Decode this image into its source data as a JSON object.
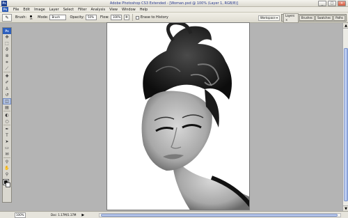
{
  "window": {
    "app_icon": "Ps",
    "title": "Adobe Photoshop CS3 Extended - [Woman.psd @ 100% (Layer 1, RGB/8)]",
    "minimize": "_",
    "maximize": "□",
    "close": "×"
  },
  "menu": {
    "logo": "Ps",
    "items": [
      "File",
      "Edit",
      "Image",
      "Layer",
      "Select",
      "Filter",
      "Analysis",
      "View",
      "Window",
      "Help"
    ]
  },
  "options": {
    "tool_icon": "✎",
    "brush_label": "Brush:",
    "brush_size": "45",
    "mode_label": "Mode:",
    "mode_value": "Brush",
    "opacity_label": "Opacity:",
    "opacity_value": "50%",
    "flow_label": "Flow:",
    "flow_value": "100%",
    "erase_history_label": "Erase to History",
    "workspace_label": "Workspace ▾"
  },
  "panels": {
    "tabs": [
      "Layers ×",
      "Brushes",
      "Swatches",
      "Paths"
    ]
  },
  "toolbox": {
    "logo": "Ps",
    "tools": [
      {
        "name": "move-tool",
        "glyph": "✥"
      },
      {
        "name": "marquee-tool",
        "glyph": "⬚"
      },
      {
        "name": "lasso-tool",
        "glyph": "ϑ"
      },
      {
        "name": "magic-wand-tool",
        "glyph": "✲"
      },
      {
        "name": "crop-tool",
        "glyph": "⌗"
      },
      {
        "name": "slice-tool",
        "glyph": "⟋"
      },
      {
        "name": "healing-brush-tool",
        "glyph": "✚"
      },
      {
        "name": "brush-tool",
        "glyph": "✐"
      },
      {
        "name": "clone-stamp-tool",
        "glyph": "♙"
      },
      {
        "name": "history-brush-tool",
        "glyph": "↺"
      },
      {
        "name": "eraser-tool",
        "glyph": "◫"
      },
      {
        "name": "gradient-tool",
        "glyph": "▤"
      },
      {
        "name": "blur-tool",
        "glyph": "◐"
      },
      {
        "name": "dodge-tool",
        "glyph": "○"
      },
      {
        "name": "pen-tool",
        "glyph": "✒"
      },
      {
        "name": "type-tool",
        "glyph": "T"
      },
      {
        "name": "path-selection-tool",
        "glyph": "➤"
      },
      {
        "name": "shape-tool",
        "glyph": "▭"
      },
      {
        "name": "notes-tool",
        "glyph": "✉"
      },
      {
        "name": "eyedropper-tool",
        "glyph": "⚲"
      },
      {
        "name": "hand-tool",
        "glyph": "✋"
      },
      {
        "name": "zoom-tool",
        "glyph": "⚲"
      }
    ],
    "active_tool": "eraser-tool",
    "foreground_color": "#000000",
    "background_color": "#ffffff"
  },
  "status": {
    "zoom": "100%",
    "doc_info": "Doc: 1.17M/1.17M",
    "arrow": "▶"
  },
  "scroll": {
    "up": "▲",
    "down": "▼"
  }
}
